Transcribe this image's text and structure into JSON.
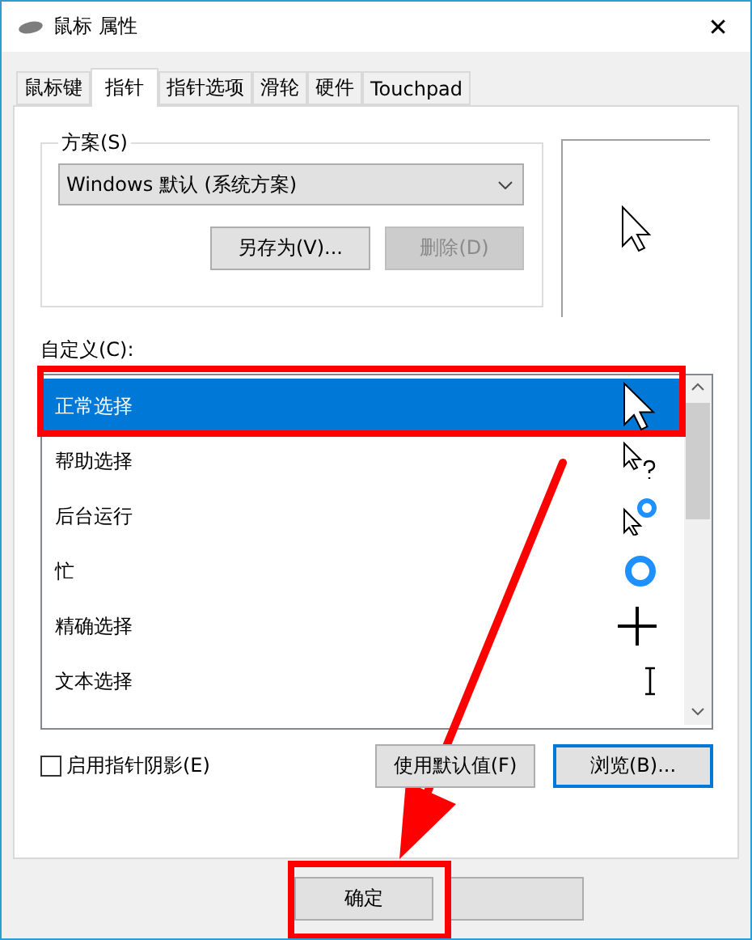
{
  "window": {
    "title": "鼠标 属性",
    "close": "✕"
  },
  "tabs": [
    {
      "label": "鼠标键",
      "selected": false
    },
    {
      "label": "指针",
      "selected": true
    },
    {
      "label": "指针选项",
      "selected": false
    },
    {
      "label": "滑轮",
      "selected": false
    },
    {
      "label": "硬件",
      "selected": false
    },
    {
      "label": "Touchpad",
      "selected": false
    }
  ],
  "scheme": {
    "label": "方案(S)",
    "value": "Windows 默认 (系统方案)",
    "buttons": [
      {
        "label": "另存为(V)...",
        "disabled": false
      },
      {
        "label": "删除(D)",
        "disabled": true
      }
    ]
  },
  "customize": {
    "label": "自定义(C):",
    "rows": [
      {
        "name": "正常选择",
        "kind": "arrow",
        "selected": true
      },
      {
        "name": "帮助选择",
        "kind": "help",
        "selected": false
      },
      {
        "name": "后台运行",
        "kind": "working",
        "selected": false
      },
      {
        "name": "忙",
        "kind": "busy",
        "selected": false
      },
      {
        "name": "精确选择",
        "kind": "precision",
        "selected": false
      },
      {
        "name": "文本选择",
        "kind": "text",
        "selected": false
      }
    ]
  },
  "shadow": {
    "label": "启用指针阴影(E)",
    "checked": false
  },
  "actions": [
    {
      "label": "使用默认值(F)",
      "focused": false
    },
    {
      "label": "浏览(B)...",
      "focused": true
    }
  ],
  "footer": [
    {
      "label": "确定"
    }
  ]
}
